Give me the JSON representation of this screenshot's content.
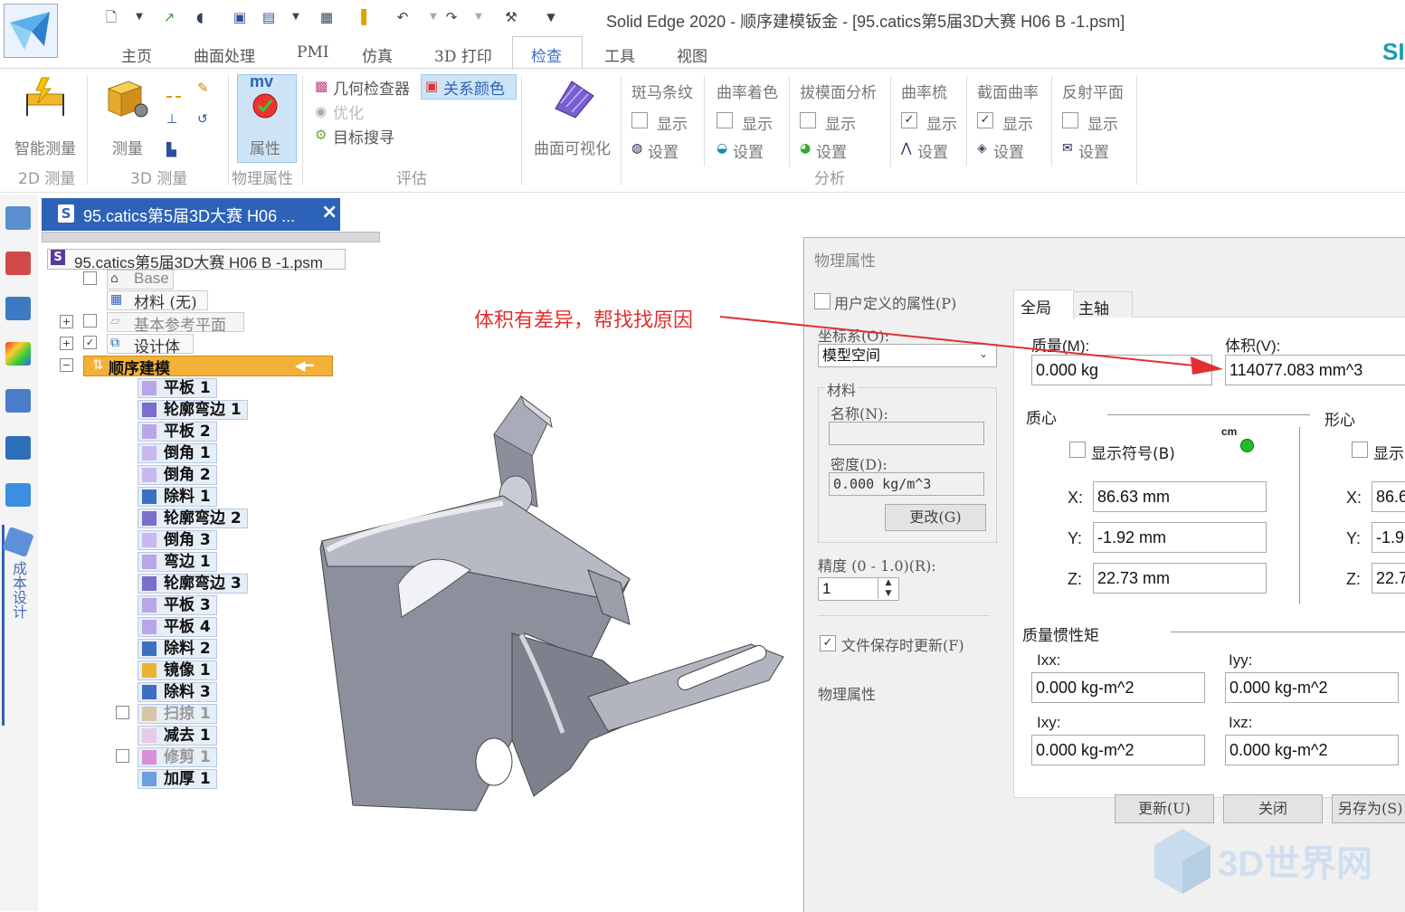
{
  "title_bar": {
    "title": "Solid Edge 2020 - 顺序建模钣金 - [95.catics第5届3D大赛 H06 B -1.psm]",
    "brand": "SI"
  },
  "menu_tabs": [
    "主页",
    "曲面处理",
    "PMI",
    "仿真",
    "3D 打印",
    "检查",
    "工具",
    "视图"
  ],
  "active_tab": "检查",
  "ribbon": {
    "smart_measure": "智能测量",
    "measure": "测量",
    "properties": "属性",
    "properties_icon_text": "mv",
    "geometry_inspector": "几何检查器",
    "relation_colors": "关系颜色",
    "optimize": "优化",
    "target_seek": "目标搜寻",
    "surface_visualize": "曲面可视化",
    "analysis_groups": [
      {
        "title": "斑马条纹",
        "show": "显示",
        "checked": false,
        "setting": "设置"
      },
      {
        "title": "曲率着色",
        "show": "显示",
        "checked": false,
        "setting": "设置"
      },
      {
        "title": "拔模面分析",
        "show": "显示",
        "checked": false,
        "setting": "设置"
      },
      {
        "title": "曲率梳",
        "show": "显示",
        "checked": true,
        "setting": "设置"
      },
      {
        "title": "截面曲率",
        "show": "显示",
        "checked": true,
        "setting": "设置"
      },
      {
        "title": "反射平面",
        "show": "显示",
        "checked": false,
        "setting": "设置"
      }
    ],
    "group_labels": {
      "measure_2d": "2D 测量",
      "measure_3d": "3D 测量",
      "physical_props": "物理属性",
      "evaluate": "评估",
      "analysis": "分析"
    }
  },
  "left_bar": {
    "cost_design": "成本设计"
  },
  "doc_tab": {
    "label": "95.catics第5届3D大赛 H06 ...",
    "close": "×"
  },
  "tree": {
    "root": "95.catics第5届3D大赛 H06 B -1.psm",
    "base": "Base",
    "material": "材料 (无)",
    "ref_planes": "基本参考平面",
    "design_body": "设计体",
    "sequential": "顺序建模",
    "features": [
      "平板 1",
      "轮廓弯边 1",
      "平板 2",
      "倒角 1",
      "倒角 2",
      "除料 1",
      "轮廓弯边 2",
      "倒角 3",
      "弯边 1",
      "轮廓弯边 3",
      "平板 3",
      "平板 4",
      "除料 2",
      "镜像 1",
      "除料 3",
      "扫掠 1",
      "减去 1",
      "修剪 1",
      "加厚 1"
    ]
  },
  "annotation": {
    "text": "体积有差异，帮找找原因",
    "color": "#e03030"
  },
  "dialog": {
    "title": "物理属性",
    "user_defined": "用户定义的属性(P)",
    "coord_system_label": "坐标系(O):",
    "coord_system_value": "模型空间",
    "material_group": "材料",
    "name_label": "名称(N):",
    "name_value": "",
    "density_label": "密度(D):",
    "density_value": "0.000 kg/m^3",
    "change_button": "更改(G)",
    "accuracy_label": "精度 (0 - 1.0)(R):",
    "accuracy_value": "1",
    "update_on_save": "文件保存时更新(F)",
    "physical_props": "物理属性",
    "tabs": [
      "全局",
      "主轴"
    ],
    "mass_label": "质量(M):",
    "mass_value": "0.000 kg",
    "volume_label": "体积(V):",
    "volume_value": "114077.083 mm^3",
    "center_of_mass": "质心",
    "centroid": "形心",
    "show_symbol": "显示符号(B)",
    "show_symbol_2": "显示",
    "cm_label": "cm",
    "com": {
      "x": "86.63 mm",
      "y": "-1.92 mm",
      "z": "22.73 mm"
    },
    "centroid_vals": {
      "x": "86.6",
      "y": "-1.9",
      "z": "22.7"
    },
    "axis_x": "X:",
    "axis_y": "Y:",
    "axis_z": "Z:",
    "inertia_title": "质量惯性矩",
    "ixx_label": "Ixx:",
    "ixx": "0.000 kg-m^2",
    "iyy_label": "Iyy:",
    "iyy": "0.000 kg-m^2",
    "ixy_label": "Ixy:",
    "ixy": "0.000 kg-m^2",
    "ixz_label": "Ixz:",
    "ixz": "0.000 kg-m^2",
    "update_button": "更新(U)",
    "close_button": "关闭",
    "save_as_button": "另存为(S)"
  },
  "watermark": "3D世界网"
}
